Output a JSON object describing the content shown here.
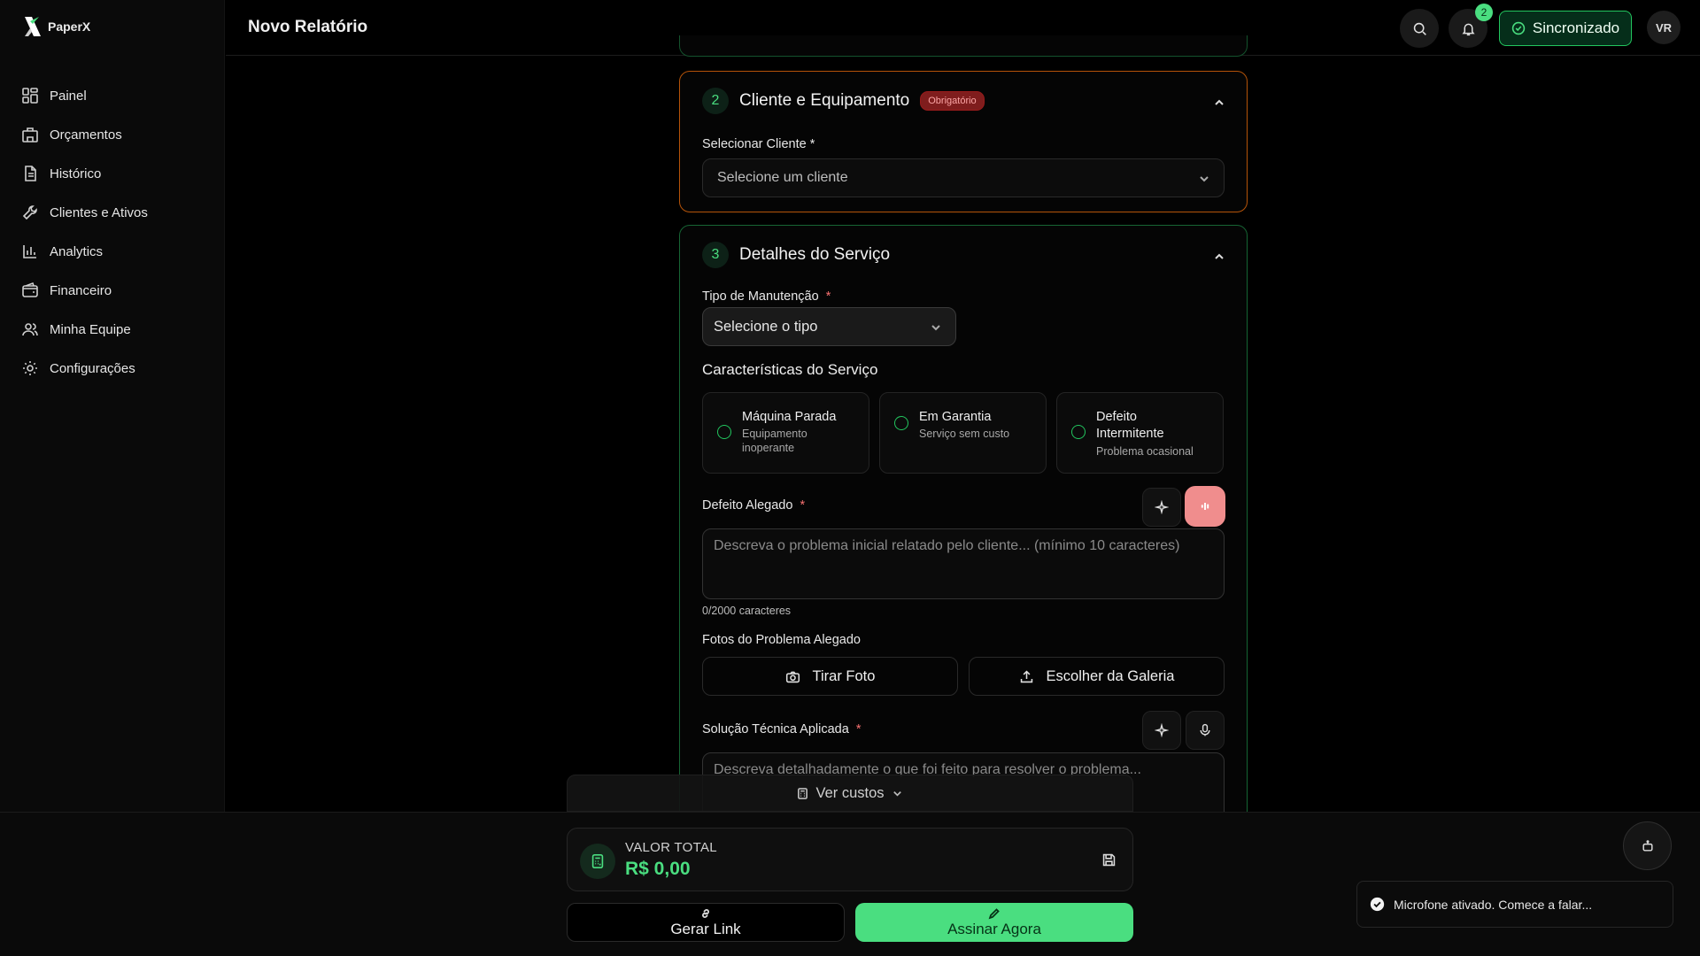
{
  "app": {
    "brand": "PaperX",
    "page_title": "Novo Relatório"
  },
  "sidebar": {
    "items": [
      {
        "label": "Painel",
        "icon": "grid-icon"
      },
      {
        "label": "Orçamentos",
        "icon": "building-icon"
      },
      {
        "label": "Histórico",
        "icon": "document-icon"
      },
      {
        "label": "Clientes e Ativos",
        "icon": "wrench-icon"
      },
      {
        "label": "Analytics",
        "icon": "bar-chart-icon"
      },
      {
        "label": "Financeiro",
        "icon": "wallet-icon"
      },
      {
        "label": "Minha Equipe",
        "icon": "users-icon"
      },
      {
        "label": "Configurações",
        "icon": "gear-icon"
      }
    ]
  },
  "header": {
    "notifications_count": "2",
    "sync_label": "Sincronizado",
    "avatar_initials": "VR"
  },
  "section2": {
    "number": "2",
    "title": "Cliente e Equipamento",
    "badge": "Obrigatório",
    "client_label": "Selecionar Cliente *",
    "client_placeholder": "Selecione um cliente"
  },
  "section3": {
    "number": "3",
    "title": "Detalhes do Serviço",
    "type_label": "Tipo de Manutenção",
    "type_placeholder": "Selecione o tipo",
    "characteristics_title": "Características do Serviço",
    "cards": [
      {
        "title": "Máquina Parada",
        "subtitle": "Equipamento inoperante"
      },
      {
        "title": "Em Garantia",
        "subtitle": "Serviço sem custo"
      },
      {
        "title": "Defeito Intermitente",
        "subtitle": "Problema ocasional"
      }
    ],
    "defect_label": "Defeito Alegado",
    "defect_placeholder": "Descreva o problema inicial relatado pelo cliente... (mínimo 10 caracteres)",
    "defect_counter": "0/2000 caracteres",
    "photos_label": "Fotos do Problema Alegado",
    "take_photo": "Tirar Foto",
    "gallery": "Escolher da Galeria",
    "solution_label": "Solução Técnica Aplicada",
    "solution_placeholder": "Descreva detalhadamente o que foi feito para resolver o problema..."
  },
  "footer": {
    "costs_label": "Ver custos",
    "total_label": "VALOR TOTAL",
    "total_value": "R$ 0,00",
    "link_label": "Gerar Link",
    "sign_label": "Assinar Agora"
  },
  "toast": {
    "message": "Microfone ativado. Comece a falar..."
  },
  "colors": {
    "accent": "#4ade80",
    "warning_border": "#b45309",
    "section_border": "#166534",
    "mic_active": "#f08d8d"
  }
}
